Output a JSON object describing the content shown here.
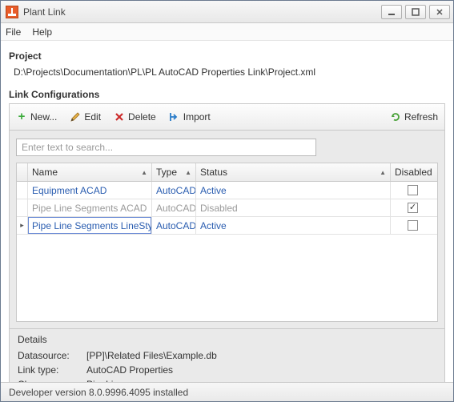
{
  "window": {
    "title": "Plant Link"
  },
  "menu": {
    "file": "File",
    "help": "Help"
  },
  "project": {
    "label": "Project",
    "path": "D:\\Projects\\Documentation\\PL\\PL AutoCAD Properties Link\\Project.xml"
  },
  "config": {
    "label": "Link Configurations",
    "toolbar": {
      "new": "New...",
      "edit": "Edit",
      "delete": "Delete",
      "import": "Import",
      "refresh": "Refresh"
    },
    "search": {
      "placeholder": "Enter text to search..."
    },
    "columns": {
      "name": "Name",
      "type": "Type",
      "status": "Status",
      "disabled": "Disabled"
    },
    "rows": [
      {
        "name": "Equipment ACAD",
        "type": "AutoCAD",
        "status": "Active",
        "disabled": false,
        "muted": false,
        "selected": false
      },
      {
        "name": "Pipe Line Segments ACAD",
        "type": "AutoCAD",
        "status": "Disabled",
        "disabled": true,
        "muted": true,
        "selected": false
      },
      {
        "name": "Pipe Line Segments LineStyles",
        "type": "AutoCAD",
        "status": "Active",
        "disabled": false,
        "muted": false,
        "selected": true
      }
    ]
  },
  "details": {
    "label": "Details",
    "datasource_label": "Datasource:",
    "datasource_value": "[PP]\\Related Files\\Example.db",
    "linktype_label": "Link type:",
    "linktype_value": "AutoCAD Properties",
    "class_label": "Class:",
    "class_value": "PipeLines"
  },
  "status": {
    "text": "Developer version 8.0.9996.4095 installed"
  }
}
